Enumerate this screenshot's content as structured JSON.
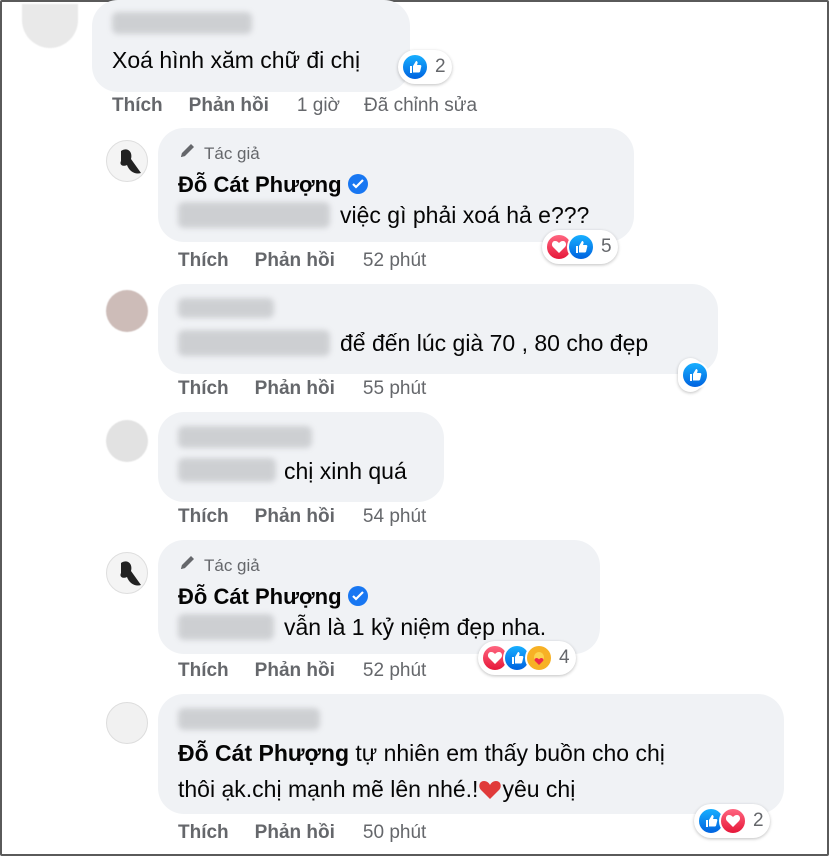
{
  "comments": [
    {
      "text": "Xoá hình xăm chữ đi chị",
      "reaction_count": "2",
      "actions": {
        "like": "Thích",
        "reply": "Phản hồi",
        "time": "1 giờ",
        "edited": "Đã chỉnh sửa"
      }
    },
    {
      "author_tag": "Tác giả",
      "author": "Đỗ Cát Phượng",
      "text": "việc gì phải xoá hả e???",
      "reaction_count": "5",
      "actions": {
        "like": "Thích",
        "reply": "Phản hồi",
        "time": "52 phút"
      }
    },
    {
      "text": "để đến lúc già 70 , 80 cho đẹp",
      "actions": {
        "like": "Thích",
        "reply": "Phản hồi",
        "time": "55 phút"
      }
    },
    {
      "text": "chị xinh quá",
      "actions": {
        "like": "Thích",
        "reply": "Phản hồi",
        "time": "54 phút"
      }
    },
    {
      "author_tag": "Tác giả",
      "author": "Đỗ Cát Phượng",
      "text": "vẫn là 1 kỷ niệm đẹp nha.",
      "reaction_count": "4",
      "actions": {
        "like": "Thích",
        "reply": "Phản hồi",
        "time": "52 phút"
      }
    },
    {
      "mention": "Đỗ Cát Phượng",
      "text_line1": "tự nhiên em thấy buồn cho chị",
      "text_line2a": "thôi ạk.chị mạnh mẽ lên nhé.!",
      "text_line2b": "yêu chị",
      "reaction_count": "2",
      "actions": {
        "like": "Thích",
        "reply": "Phản hồi",
        "time": "50 phút"
      }
    }
  ],
  "colors": {
    "like": "#1877f2",
    "love": "#f02849",
    "secondary_text": "#65676b",
    "bubble": "#f0f2f5"
  },
  "icons": [
    "like-icon",
    "love-icon",
    "care-icon",
    "verified-badge-icon",
    "pen-icon",
    "heart-emoji-icon"
  ]
}
